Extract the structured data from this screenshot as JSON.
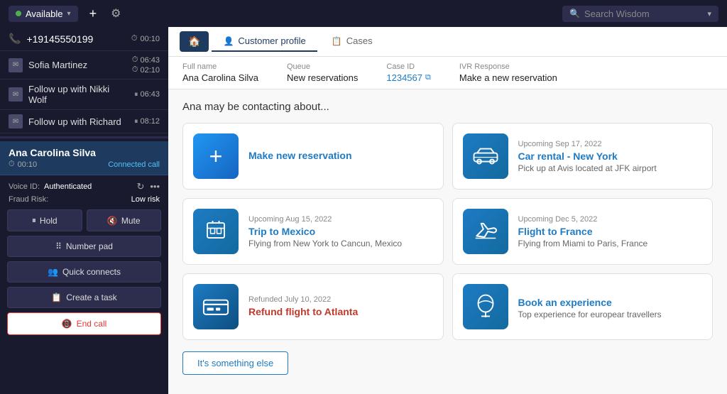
{
  "topNav": {
    "statusLabel": "Available",
    "addIcon": "+",
    "settingsIcon": "⚙",
    "searchPlaceholder": "Search Wisdom",
    "chevronIcon": "▾"
  },
  "leftPanel": {
    "incomingCall": {
      "icon": "📞",
      "number": "+19145550199",
      "timerIcon": "🕐",
      "timer": "00:10"
    },
    "queueItems": [
      {
        "icon": "✉",
        "name": "Sofia Martinez",
        "time1Icon": "🕐",
        "time1": "06:43",
        "time2Icon": "🕐",
        "time2": "02:10"
      },
      {
        "icon": "✉",
        "name": "Follow up with Nikki Wolf",
        "pauseIcon": "⏸",
        "time": "06:43"
      },
      {
        "icon": "✉",
        "name": "Follow up with Richard",
        "pauseIcon": "⏸",
        "time": "08:12"
      }
    ],
    "activeCall": {
      "name": "Ana Carolina Silva",
      "timer": "00:10",
      "status": "Connected call",
      "voiceIdLabel": "Voice ID:",
      "voiceIdVal": "Authenticated",
      "fraudLabel": "Fraud Risk:",
      "fraudVal": "Low risk"
    },
    "controls": {
      "holdLabel": "Hold",
      "muteLabel": "Mute",
      "numberPadLabel": "Number pad",
      "quickConnectsLabel": "Quick connects",
      "createTaskLabel": "Create a task",
      "endCallLabel": "End call"
    }
  },
  "rightPanel": {
    "tabs": {
      "homeIcon": "🏠",
      "customerProfileLabel": "Customer profile",
      "customerProfileIcon": "👤",
      "casesLabel": "Cases",
      "casesIcon": "📋"
    },
    "infoBar": {
      "fullNameLabel": "Full name",
      "fullNameVal": "Ana Carolina Silva",
      "queueLabel": "Queue",
      "queueVal": "New reservations",
      "caseIdLabel": "Case ID",
      "caseIdVal": "1234567",
      "copyIcon": "⧉",
      "ivrLabel": "IVR Response",
      "ivrVal": "Make a new reservation"
    },
    "sectionTitle": "Ana may be contacting about...",
    "cards": [
      {
        "icon": "+",
        "subtitle": "",
        "title": "Make new reservation",
        "desc": "",
        "iconStyle": "plus"
      },
      {
        "icon": "🚗",
        "subtitle": "Upcoming Sep 17, 2022",
        "title": "Car rental - New York",
        "desc": "Pick up at Avis located at JFK airport",
        "iconStyle": "car"
      },
      {
        "icon": "🧳",
        "subtitle": "Upcoming Aug 15, 2022",
        "title": "Trip to Mexico",
        "desc": "Flying from New York to Cancun, Mexico",
        "iconStyle": "luggage"
      },
      {
        "icon": "✈",
        "subtitle": "Upcoming Dec 5, 2022",
        "title": "Flight to France",
        "desc": "Flying from Miami to Paris, France",
        "iconStyle": "plane"
      },
      {
        "icon": "💳",
        "subtitle": "Refunded July 10, 2022",
        "title": "Refund flight to Atlanta",
        "desc": "",
        "iconStyle": "card"
      },
      {
        "icon": "🎈",
        "subtitle": "",
        "title": "Book an experience",
        "desc": "Top experience for europear travellers",
        "iconStyle": "balloon"
      }
    ],
    "somethingElseLabel": "It's something else"
  }
}
